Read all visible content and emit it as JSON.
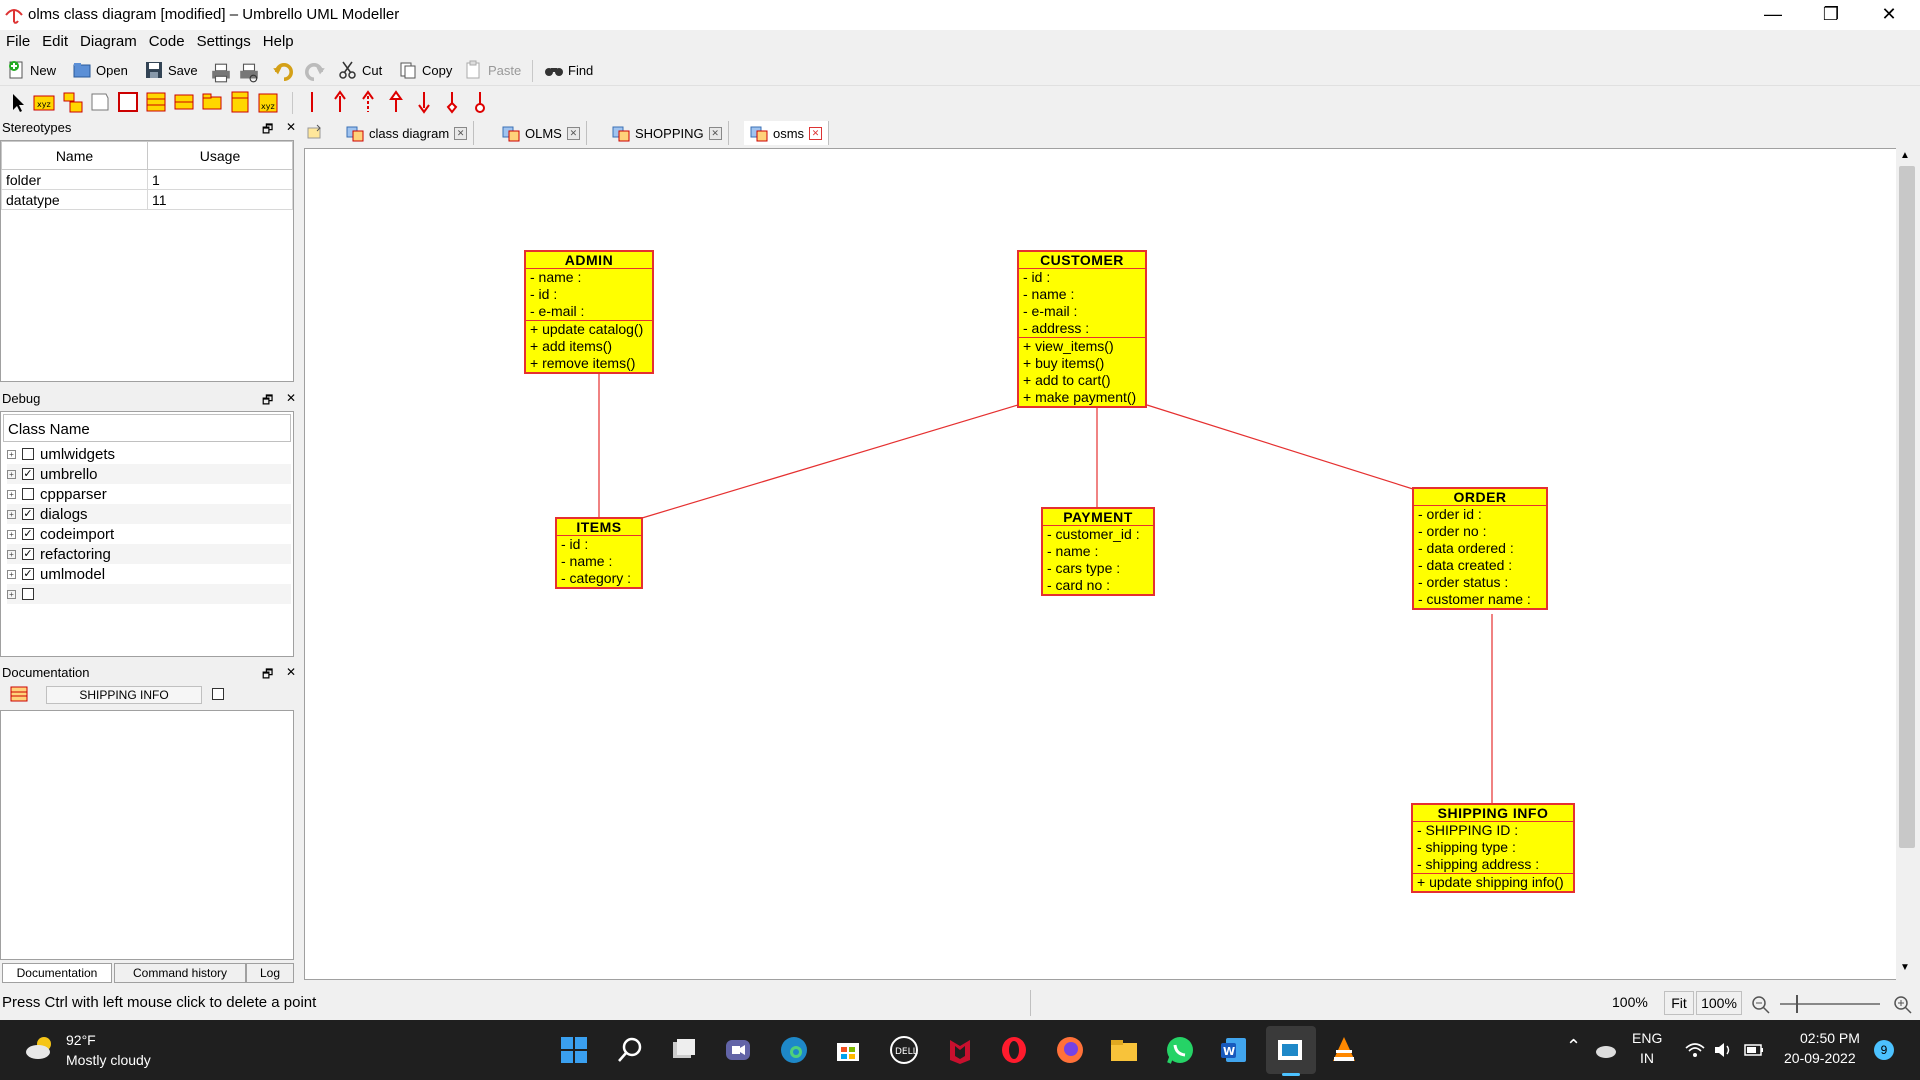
{
  "window": {
    "title": "olms class diagram [modified] – Umbrello UML Modeller",
    "minimize": "—",
    "restore": "❐",
    "close": "✕"
  },
  "menu": [
    "File",
    "Edit",
    "Diagram",
    "Code",
    "Settings",
    "Help"
  ],
  "toolbar": {
    "new": "New",
    "open": "Open",
    "save": "Save",
    "cut": "Cut",
    "copy": "Copy",
    "paste": "Paste",
    "find": "Find"
  },
  "stereotypes": {
    "title": "Stereotypes",
    "col_name": "Name",
    "col_usage": "Usage",
    "rows": [
      {
        "name": "folder",
        "usage": "1"
      },
      {
        "name": "datatype",
        "usage": "11"
      }
    ]
  },
  "debug": {
    "title": "Debug",
    "header": "Class Name",
    "items": [
      {
        "label": "umlwidgets",
        "checked": false
      },
      {
        "label": "umbrello",
        "checked": true
      },
      {
        "label": "cppparser",
        "checked": false
      },
      {
        "label": "dialogs",
        "checked": true
      },
      {
        "label": "codeimport",
        "checked": true
      },
      {
        "label": "refactoring",
        "checked": true
      },
      {
        "label": "umlmodel",
        "checked": true
      },
      {
        "label": "",
        "checked": false
      }
    ]
  },
  "documentation": {
    "title": "Documentation",
    "selected": "SHIPPING INFO",
    "tabs": [
      "Documentation",
      "Command history",
      "Log"
    ]
  },
  "tabs": [
    {
      "label": "class diagram",
      "active": false
    },
    {
      "label": "OLMS",
      "active": false
    },
    {
      "label": "SHOPPING",
      "active": false
    },
    {
      "label": "osms",
      "active": true
    }
  ],
  "diagram": {
    "admin": {
      "name": "ADMIN",
      "attrs": [
        "- name :",
        "- id :",
        "- e-mail :"
      ],
      "ops": [
        "+ update catalog()",
        "+ add items()",
        "+ remove items()"
      ]
    },
    "customer": {
      "name": "CUSTOMER",
      "attrs": [
        "- id :",
        "- name :",
        "- e-mail :",
        "- address :"
      ],
      "ops": [
        "+ view_items()",
        "+ buy items()",
        "+ add to cart()",
        "+ make payment()"
      ]
    },
    "items": {
      "name": "ITEMS",
      "attrs": [
        "- id :",
        "- name :",
        "- category :"
      ]
    },
    "payment": {
      "name": "PAYMENT",
      "attrs": [
        "- customer_id :",
        "- name :",
        "- cars type :",
        "- card no :"
      ]
    },
    "order": {
      "name": "ORDER",
      "attrs": [
        "- order id :",
        "- order no :",
        "- data ordered :",
        "- data created :",
        "- order status :",
        "- customer name :"
      ]
    },
    "shipping": {
      "name": "SHIPPING INFO",
      "attrs": [
        "- SHIPPING ID :",
        "- shipping type :",
        "- shipping address :"
      ],
      "ops": [
        "+ update shipping info()"
      ]
    }
  },
  "status": {
    "message": "Press Ctrl with left mouse click to delete a point",
    "zoom1": "100%",
    "fit": "Fit",
    "zoom2": "100%"
  },
  "taskbar": {
    "temp": "92°F",
    "weather": "Mostly cloudy",
    "lang1": "ENG",
    "lang2": "IN",
    "time": "02:50 PM",
    "date": "20-09-2022",
    "badge": "9"
  },
  "colors": {
    "class_fill": "#ffff00",
    "class_border": "#e53030",
    "accent": "#0078d4"
  }
}
